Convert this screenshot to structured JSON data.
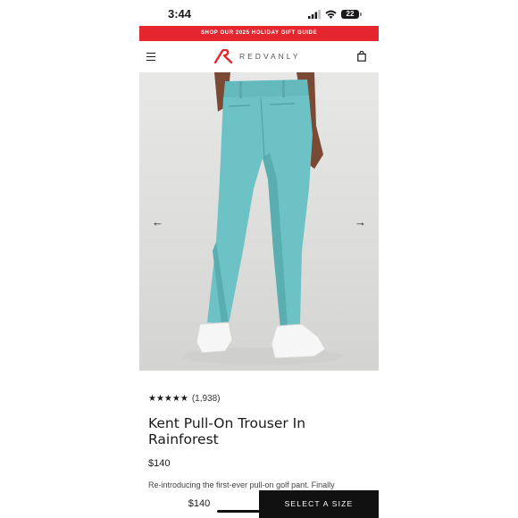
{
  "status_bar": {
    "time": "3:44",
    "battery": "22"
  },
  "promo_banner": {
    "text": "SHOP OUR 2025 HOLIDAY GIFT GUIDE"
  },
  "header": {
    "brand": "REDVANLY"
  },
  "carousel": {
    "prev_icon": "←",
    "next_icon": "→"
  },
  "product": {
    "rating_stars": "★★★★★",
    "review_count": "(1,938)",
    "title": "Kent Pull-On Trouser In Rainforest",
    "price": "$140",
    "description": "Re-introducing the first-ever pull-on golf pant. Finally"
  },
  "sticky_bar": {
    "price": "$140",
    "cta_label": "SELECT A SIZE"
  },
  "colors": {
    "brand_red": "#e5262e",
    "pants": "#6cc2c4",
    "cta": "#111111"
  },
  "icons": [
    "signal-icon",
    "wifi-icon",
    "battery-icon",
    "menu-icon",
    "bag-icon",
    "arrow-left-icon",
    "arrow-right-icon",
    "star-icon"
  ]
}
